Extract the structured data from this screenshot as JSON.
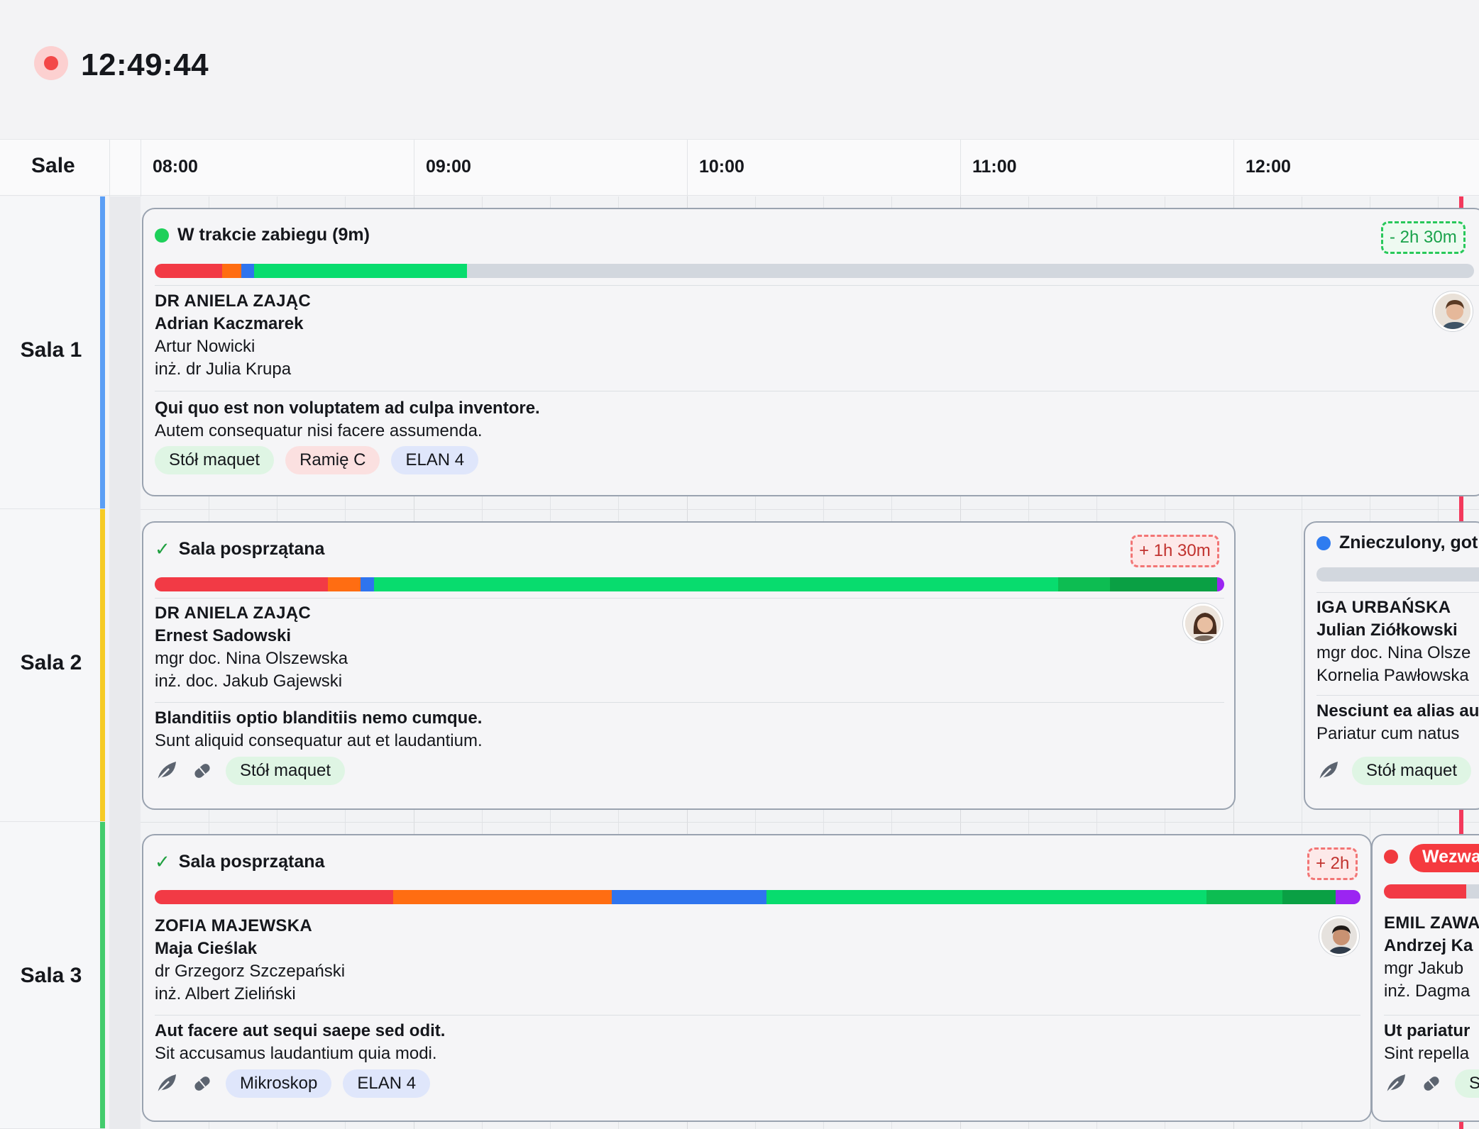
{
  "clock": {
    "time": "12:49:44"
  },
  "header": {
    "rooms_label": "Sale",
    "hours": [
      "08:00",
      "09:00",
      "10:00",
      "11:00",
      "12:00"
    ]
  },
  "rooms": [
    {
      "name": "Sala 1",
      "color": "#5b9ef5"
    },
    {
      "name": "Sala 2",
      "color": "#f6cb25"
    },
    {
      "name": "Sala 3",
      "color": "#43cc6c"
    }
  ],
  "cards": [
    {
      "status": "W trakcie zabiegu (9m)",
      "status_color": "#1ed05a",
      "badge": "- 2h 30m",
      "lead": "DR ANIELA ZAJĄC",
      "patient": "Adrian Kaczmarek",
      "staff": [
        "Artur Nowicki",
        "inż. dr Julia Krupa"
      ],
      "title": "Qui quo est non voluptatem ad culpa inventore.",
      "subtitle": "Autem consequatur nisi facere assumenda.",
      "tags": [
        "Stół maquet",
        "Ramię C",
        "ELAN 4"
      ]
    },
    {
      "status": "Sala posprzątana",
      "badge": "+ 1h 30m",
      "lead": "DR ANIELA ZAJĄC",
      "patient": "Ernest Sadowski",
      "staff": [
        "mgr doc. Nina Olszewska",
        "inż. doc. Jakub Gajewski"
      ],
      "title": "Blanditiis optio blanditiis nemo cumque.",
      "subtitle": "Sunt aliquid consequatur aut et laudantium.",
      "tags": [
        "Stół maquet"
      ],
      "icons": [
        "leaf-icon",
        "pill-icon"
      ]
    },
    {
      "status": "Znieczulony, got",
      "status_color": "#2f7cf0",
      "lead": "IGA URBAŃSKA",
      "patient": "Julian Ziółkowski",
      "staff": [
        "mgr doc. Nina Olsze",
        "Kornelia Pawłowska"
      ],
      "title": "Nesciunt ea alias au",
      "subtitle": "Pariatur cum natus",
      "tags": [
        "Stół maquet"
      ],
      "icons": [
        "leaf-icon"
      ]
    },
    {
      "status": "Sala posprzątana",
      "badge": "+ 2h",
      "lead": "ZOFIA MAJEWSKA",
      "patient": "Maja Cieślak",
      "staff": [
        "dr Grzegorz Szczepański",
        "inż. Albert Zieliński"
      ],
      "title": "Aut facere aut sequi saepe sed odit.",
      "subtitle": "Sit accusamus laudantium quia modi.",
      "tags": [
        "Mikroskop",
        "ELAN 4"
      ],
      "icons": [
        "leaf-icon",
        "pill-icon"
      ]
    },
    {
      "status": "Wezwa",
      "status_color": "#f03a3f",
      "lead": "EMIL ZAWA",
      "patient": "Andrzej Ka",
      "staff": [
        "mgr Jakub",
        "inż. Dagma"
      ],
      "title": "Ut pariatur",
      "subtitle": "Sint repella",
      "tags": [
        "St"
      ],
      "icons": [
        "leaf-icon",
        "pill-icon"
      ]
    }
  ],
  "colors": {
    "red": "#f23a45",
    "orange": "#ff6d12",
    "blue": "#2f74ee",
    "green": "#08dc6e",
    "green_dark": "#0dbd52",
    "green_darker": "#0aa044",
    "purple": "#9b25f2",
    "track": "#d2d7de",
    "now_line": "#f3395c"
  }
}
